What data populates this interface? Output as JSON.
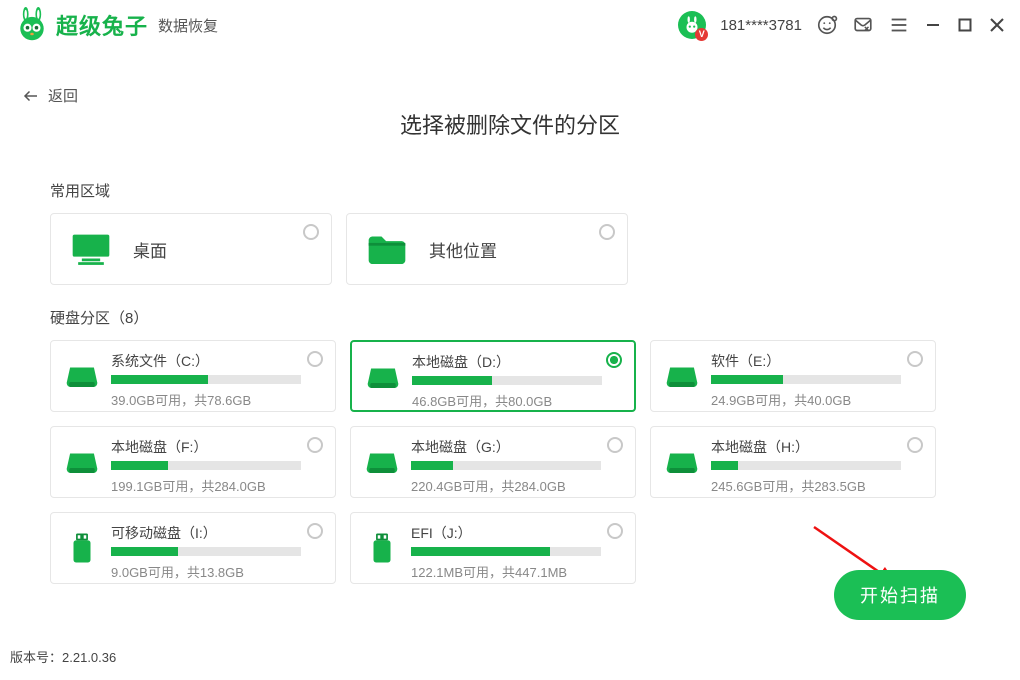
{
  "brand": {
    "name": "超级兔子",
    "sub": "数据恢复"
  },
  "header": {
    "phone": "181****3781"
  },
  "back_label": "返回",
  "page_title": "选择被删除文件的分区",
  "quick_section_label": "常用区域",
  "quick": {
    "desktop": "桌面",
    "other": "其他位置"
  },
  "partitions_section_label_prefix": "硬盘分区",
  "partitions_count_paren": "（8）",
  "partitions": [
    {
      "name": "系统文件（C:）",
      "stat": "39.0GB可用，共78.6GB",
      "fill_pct": 51,
      "kind": "hdd",
      "selected": false
    },
    {
      "name": "本地磁盘（D:）",
      "stat": "46.8GB可用，共80.0GB",
      "fill_pct": 42,
      "kind": "hdd",
      "selected": true
    },
    {
      "name": "软件（E:）",
      "stat": "24.9GB可用，共40.0GB",
      "fill_pct": 38,
      "kind": "hdd",
      "selected": false
    },
    {
      "name": "本地磁盘（F:）",
      "stat": "199.1GB可用，共284.0GB",
      "fill_pct": 30,
      "kind": "hdd",
      "selected": false
    },
    {
      "name": "本地磁盘（G:）",
      "stat": "220.4GB可用，共284.0GB",
      "fill_pct": 22,
      "kind": "hdd",
      "selected": false
    },
    {
      "name": "本地磁盘（H:）",
      "stat": "245.6GB可用，共283.5GB",
      "fill_pct": 14,
      "kind": "hdd",
      "selected": false
    },
    {
      "name": "可移动磁盘（I:）",
      "stat": "9.0GB可用，共13.8GB",
      "fill_pct": 35,
      "kind": "usb",
      "selected": false
    },
    {
      "name": "EFI（J:）",
      "stat": "122.1MB可用，共447.1MB",
      "fill_pct": 73,
      "kind": "usb",
      "selected": false
    }
  ],
  "scan_button": "开始扫描",
  "version_prefix": "版本号：",
  "version": "2.21.0.36",
  "colors": {
    "accent": "#17b24b"
  }
}
